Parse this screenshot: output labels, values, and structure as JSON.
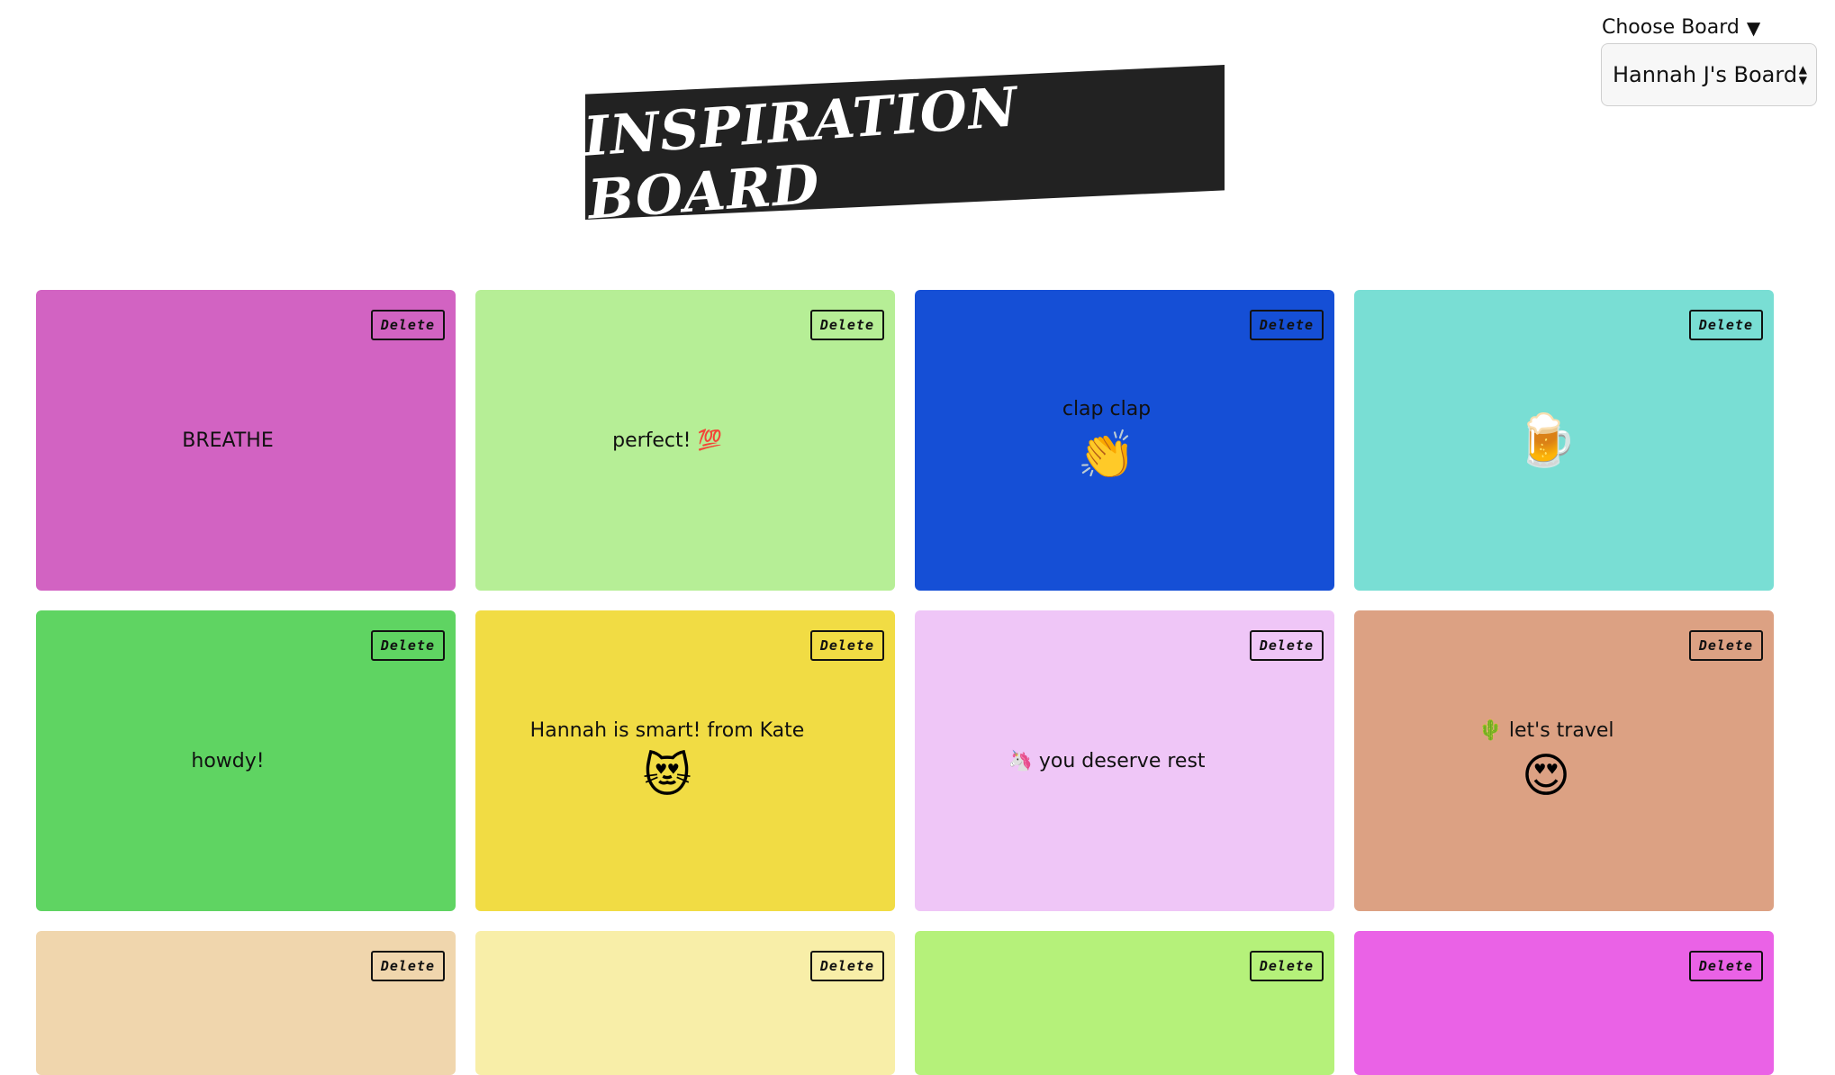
{
  "header": {
    "title": "Inspiration Board",
    "chooser_label": "Choose Board",
    "chooser_arrow": "▼",
    "selected_board": "Hannah J's Board"
  },
  "delete_label": "Delete",
  "cards": [
    {
      "text": "BREATHE",
      "emoji": "",
      "color": "#d263c2"
    },
    {
      "text": "perfect! 💯",
      "emoji": "",
      "color": "#b6ee96"
    },
    {
      "text": "clap clap",
      "emoji": "👏",
      "color": "#154fd6"
    },
    {
      "text": "",
      "emoji": "🍺",
      "color": "#79ded4"
    },
    {
      "text": "howdy!",
      "emoji": "",
      "color": "#5fd462"
    },
    {
      "text": "Hannah is smart! from Kate",
      "emoji": "😻",
      "color": "#f1dc44"
    },
    {
      "text": "🦄 you deserve rest",
      "emoji": "",
      "color": "#efc6f7"
    },
    {
      "text": "🌵 let's travel",
      "emoji": "😍",
      "color": "#dca183"
    },
    {
      "text": "",
      "emoji": "",
      "color": "#f0d6ad"
    },
    {
      "text": "",
      "emoji": "",
      "color": "#f8eea8"
    },
    {
      "text": "",
      "emoji": "",
      "color": "#b5f17a"
    },
    {
      "text": "",
      "emoji": "",
      "color": "#ea62e6"
    }
  ]
}
